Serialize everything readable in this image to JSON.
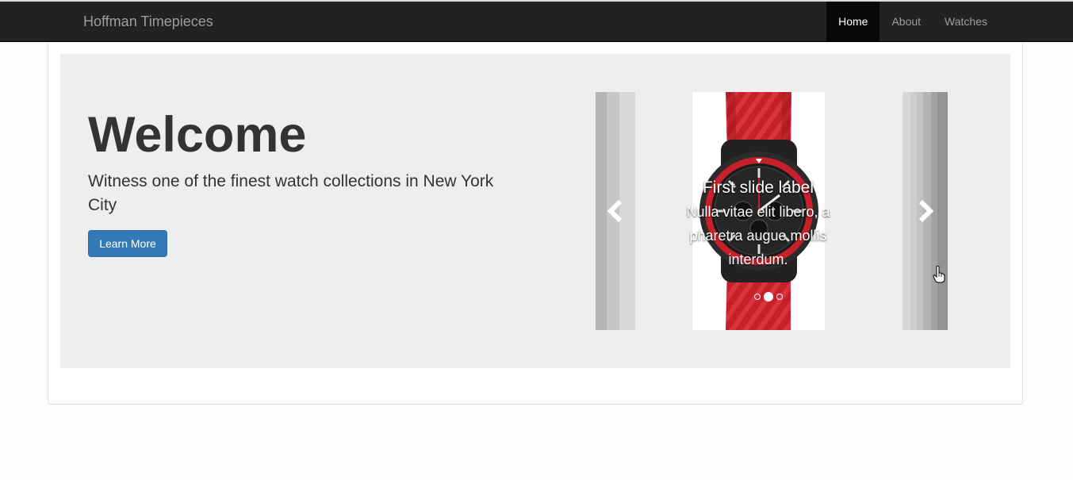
{
  "navbar": {
    "brand": "Hoffman Timepieces",
    "items": [
      {
        "label": "Home",
        "active": true
      },
      {
        "label": "About",
        "active": false
      },
      {
        "label": "Watches",
        "active": false
      }
    ]
  },
  "hero": {
    "title": "Welcome",
    "subtitle": "Witness one of the finest watch collections in New York City",
    "button_label": "Learn More"
  },
  "carousel": {
    "caption_title": "First slide label",
    "caption_text": "Nulla vitae elit libero, a pharetra augue mollis interdum.",
    "slide_image": "red-strap-watch",
    "indicators": 3,
    "active_indicator": 1,
    "prev_icon": "chevron-left-icon",
    "next_icon": "chevron-right-icon"
  },
  "colors": {
    "navbar_bg": "#222222",
    "jumbotron_bg": "#eeeeee",
    "primary_button": "#337ab7",
    "watch_strap": "#c8202a"
  }
}
